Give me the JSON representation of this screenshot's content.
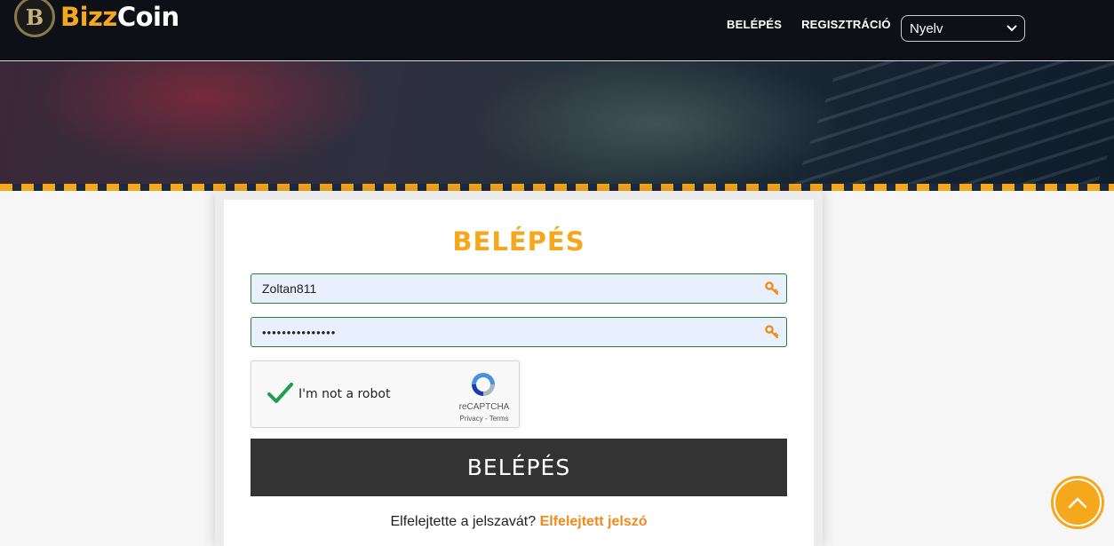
{
  "header": {
    "logo": {
      "bizz": "Bizz",
      "coin": "Coin",
      "mark": "B"
    },
    "nav": {
      "login": "BELÉPÉS",
      "register": "REGISZTRÁCIÓ"
    },
    "language_select": {
      "value": "Nyelv"
    }
  },
  "login": {
    "title": "BELÉPÉS",
    "username_value": "Zoltan811",
    "password_value": "•••••••••••••••",
    "captcha": {
      "label": "I'm not a robot",
      "brand": "reCAPTCHA",
      "links": "Privacy - Terms"
    },
    "submit_label": "BELÉPÉS",
    "forgot_text": "Elfelejtette a jelszavát?",
    "forgot_link": "Elfelejtett jelszó"
  },
  "colors": {
    "accent": "#f6a81c",
    "header_bg": "#0d1117",
    "button_bg": "#333333",
    "link": "#f08a1c"
  },
  "icons": {
    "key": "key-icon",
    "scroll_top": "chevron-up-icon",
    "check": "check-icon"
  }
}
